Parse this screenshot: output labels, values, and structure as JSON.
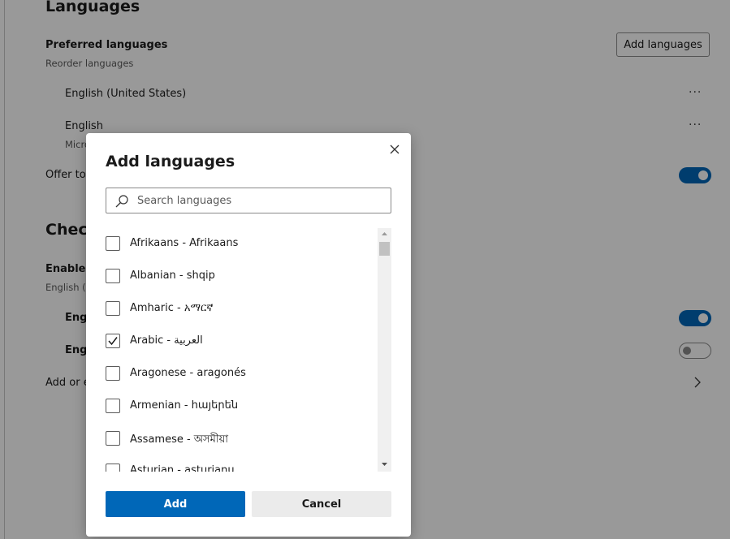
{
  "settings": {
    "section_title": "Languages",
    "preferred_label": "Preferred languages",
    "preferred_sub": "Reorder languages",
    "add_languages_button": "Add languages",
    "languages": [
      {
        "name": "English (United States)",
        "more": "···"
      },
      {
        "name": "English",
        "sub": "Micro",
        "more": "···"
      }
    ],
    "offer_label": "Offer to",
    "check_title": "Check",
    "enable_label": "Enable s",
    "enable_sub": "English (U",
    "spell_items": [
      "Engl",
      "Engl"
    ],
    "add_or_label": "Add or e"
  },
  "dialog": {
    "title": "Add languages",
    "search_placeholder": "Search languages",
    "items": [
      {
        "label": "Afrikaans - Afrikaans",
        "checked": false
      },
      {
        "label": "Albanian - shqip",
        "checked": false
      },
      {
        "label": "Amharic - አማርኛ",
        "checked": false
      },
      {
        "label": "Arabic - العربية",
        "checked": true
      },
      {
        "label": "Aragonese - aragonés",
        "checked": false
      },
      {
        "label": "Armenian - հայերեն",
        "checked": false
      },
      {
        "label": "Assamese - অসমীয়া",
        "checked": false
      },
      {
        "label": "Asturian - asturianu",
        "checked": false
      }
    ],
    "add_button": "Add",
    "cancel_button": "Cancel"
  },
  "colors": {
    "accent": "#0067b8",
    "overlay": "rgba(0,0,0,0.40)"
  }
}
